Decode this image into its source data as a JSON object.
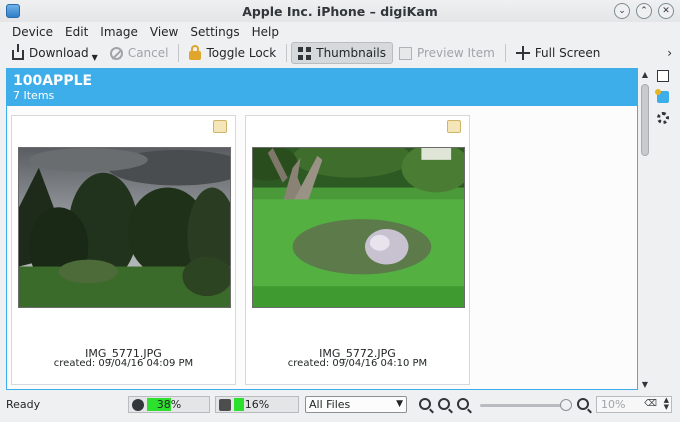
{
  "window": {
    "title": "Apple Inc. iPhone – digiKam"
  },
  "menu": [
    {
      "label": "Device"
    },
    {
      "label": "Edit"
    },
    {
      "label": "Image"
    },
    {
      "label": "View"
    },
    {
      "label": "Settings"
    },
    {
      "label": "Help"
    }
  ],
  "toolbar": {
    "download": "Download",
    "cancel": "Cancel",
    "toggle_lock": "Toggle Lock",
    "thumbnails": "Thumbnails",
    "preview_item": "Preview Item",
    "full_screen": "Full Screen",
    "more": "›"
  },
  "album": {
    "name": "100APPLE",
    "count": "7 Items"
  },
  "items": [
    {
      "filename": "IMG_5771.JPG",
      "created": "created: 09/04/16 04:09 PM"
    },
    {
      "filename": "IMG_5772.JPG",
      "created": "created: 09/04/16 04:10 PM"
    }
  ],
  "status": {
    "text": "Ready",
    "meter1": {
      "label": "38%",
      "value": 0.38
    },
    "meter2": {
      "label": "16%",
      "value": 0.16
    },
    "filter": "All Files",
    "zoom": "10%"
  },
  "colors": {
    "accent": "#3daee9",
    "meter": "#2ee02e"
  }
}
